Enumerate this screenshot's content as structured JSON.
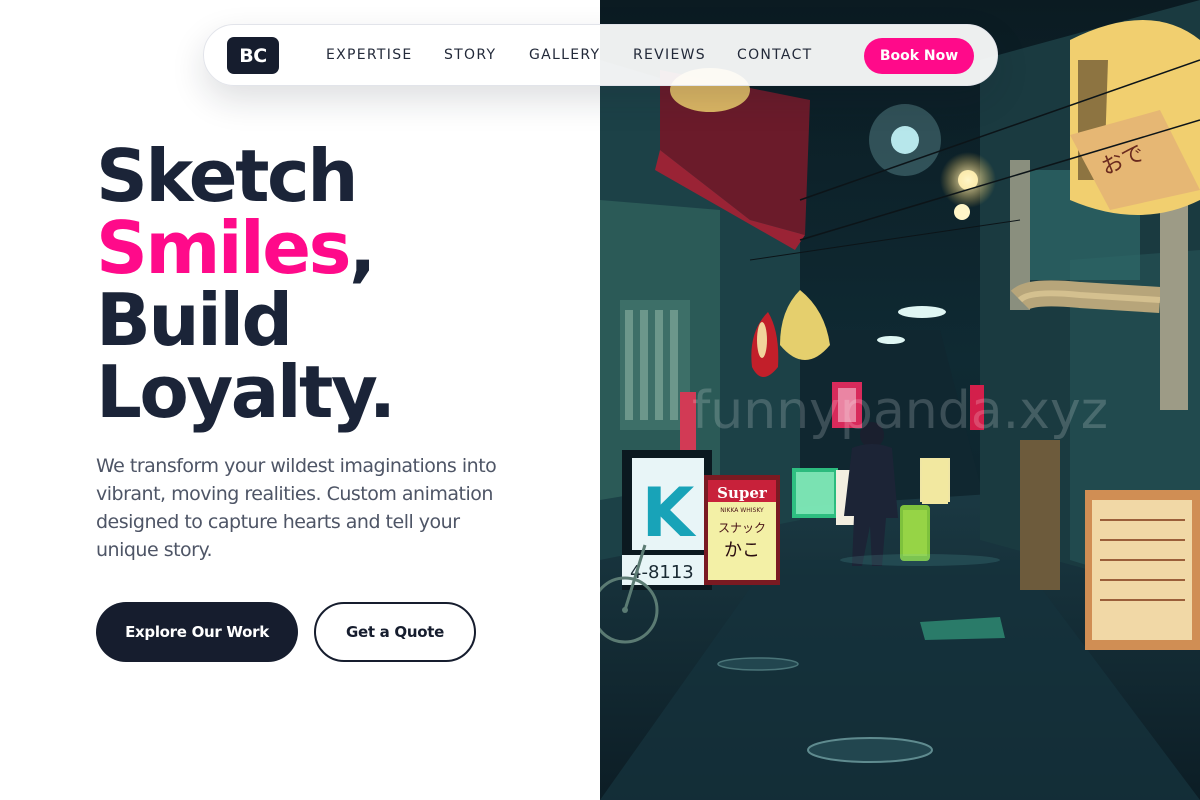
{
  "brand": {
    "logo_text": "BC"
  },
  "nav": {
    "links": [
      "EXPERTISE",
      "STORY",
      "GALLERY",
      "REVIEWS",
      "CONTACT"
    ],
    "cta": "Book Now"
  },
  "hero": {
    "title_line1": "Sketch",
    "title_accent": "Smiles",
    "title_comma": ",",
    "title_line3": "Build",
    "title_line4": "Loyalty.",
    "description": "We transform your wildest imaginations into vibrant, moving realities. Custom animation designed to capture hearts and tell your unique story.",
    "primary_button": "Explore Our Work",
    "secondary_button": "Get a Quote"
  },
  "photo": {
    "watermark": "funnypanda.xyz",
    "sign_super": "Super",
    "sign_super_sub": "NIKKA WHISKY",
    "sign_katakana": "スナック",
    "sign_kanji": "かこ",
    "sign_letter": "K",
    "sign_phone": "4-8113"
  },
  "colors": {
    "accent": "#ff0a8a",
    "dark": "#161d2e",
    "text": "#1b2438",
    "muted": "#4e5566"
  }
}
